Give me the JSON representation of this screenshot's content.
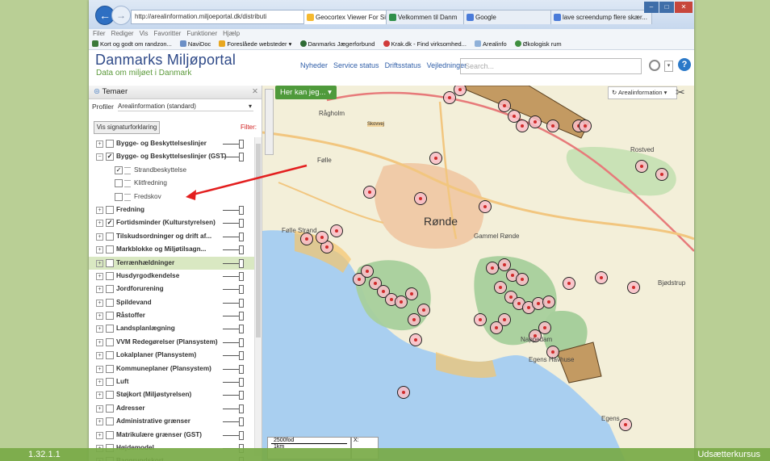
{
  "browser": {
    "address": "http://arealinformation.miljoeportal.dk/distributi",
    "tabs": [
      {
        "label": "Geocortex Viewer For Silv...",
        "active": true,
        "color": "#f5b92f"
      },
      {
        "label": "Velkommen til Danm",
        "active": false,
        "color": "#2f8f4a"
      },
      {
        "label": "Google",
        "active": false,
        "color": "#4a7bd9"
      },
      {
        "label": "lave screendump flere skær...",
        "active": false,
        "color": "#4a7bd9"
      }
    ],
    "menu": [
      "Filer",
      "Rediger",
      "Vis",
      "Favoritter",
      "Funktioner",
      "Hjælp"
    ],
    "favorites": [
      "Kort og godt om randzon...",
      "NaviDoc",
      "Foreslåede websteder ▾",
      "Danmarks Jægerforbund",
      "Krak.dk - Find virksomhed...",
      "Arealinfo",
      "Økologisk rum"
    ]
  },
  "app": {
    "logo_title": "Danmarks Miljøportal",
    "logo_subtitle": "Data om miljøet i Danmark",
    "nav": [
      "Nyheder",
      "Service status",
      "Driftsstatus",
      "Vejledninger"
    ],
    "search_placeholder": "Search..."
  },
  "sidebar": {
    "title": "Temaer",
    "profile_label": "Profiler",
    "profile_value": "Arealinformation (standard)",
    "signature_button": "Vis signaturforklaring",
    "filter_label": "Filter:",
    "layers": [
      {
        "label": "Bygge- og Beskyttelseslinjer",
        "sub": false,
        "checked": false,
        "expanded": false
      },
      {
        "label": "Bygge- og Beskyttelseslinjer (GST)",
        "sub": false,
        "checked": true,
        "expanded": true
      },
      {
        "label": "Strandbeskyttelse",
        "sub": true,
        "checked": true
      },
      {
        "label": "Klitfredning",
        "sub": true,
        "checked": false
      },
      {
        "label": "Fredskov",
        "sub": true,
        "checked": false
      },
      {
        "label": "Fredning",
        "sub": false,
        "checked": false,
        "expanded": false
      },
      {
        "label": "Fortidsminder (Kulturstyrelsen)",
        "sub": false,
        "checked": true,
        "expanded": false
      },
      {
        "label": "Tilskudsordninger og drift af...",
        "sub": false,
        "checked": false,
        "expanded": false
      },
      {
        "label": "Markblokke og Miljøtilsagn...",
        "sub": false,
        "checked": false,
        "expanded": false
      },
      {
        "label": "Terrænhældninger",
        "sub": false,
        "checked": false,
        "expanded": false,
        "highlight": true
      },
      {
        "label": "Husdyrgodkendelse",
        "sub": false,
        "checked": false,
        "expanded": false
      },
      {
        "label": "Jordforurening",
        "sub": false,
        "checked": false,
        "expanded": false
      },
      {
        "label": "Spildevand",
        "sub": false,
        "checked": false,
        "expanded": false
      },
      {
        "label": "Råstoffer",
        "sub": false,
        "checked": false,
        "expanded": false
      },
      {
        "label": "Landsplanlægning",
        "sub": false,
        "checked": false,
        "expanded": false
      },
      {
        "label": "VVM Redegørelser (Plansystem)",
        "sub": false,
        "checked": false,
        "expanded": false
      },
      {
        "label": "Lokalplaner (Plansystem)",
        "sub": false,
        "checked": false,
        "expanded": false
      },
      {
        "label": "Kommuneplaner (Plansystem)",
        "sub": false,
        "checked": false,
        "expanded": false
      },
      {
        "label": "Luft",
        "sub": false,
        "checked": false,
        "expanded": false
      },
      {
        "label": "Støjkort (Miljøstyrelsen)",
        "sub": false,
        "checked": false,
        "expanded": false
      },
      {
        "label": "Adresser",
        "sub": false,
        "checked": false,
        "expanded": false
      },
      {
        "label": "Administrative grænser",
        "sub": false,
        "checked": false,
        "expanded": false
      },
      {
        "label": "Matrikulære grænser (GST)",
        "sub": false,
        "checked": false,
        "expanded": false
      },
      {
        "label": "Højdemodel",
        "sub": false,
        "checked": false,
        "expanded": false
      },
      {
        "label": "Baggrundskort",
        "sub": false,
        "checked": false,
        "expanded": false
      }
    ]
  },
  "map": {
    "her_kan_jeg": "Her kan jeg... ▾",
    "area_button": "Arealinformation ▾",
    "scale_top": "2500fod",
    "scale_bottom": "1km",
    "coord_label": "X:",
    "places": [
      {
        "name": "Rågholm",
        "cls": ""
      },
      {
        "name": "Rønde",
        "cls": "big"
      },
      {
        "name": "Følle Strand",
        "cls": ""
      },
      {
        "name": "Rostved",
        "cls": ""
      },
      {
        "name": "Bjødstrup",
        "cls": ""
      },
      {
        "name": "Egens Havhuse",
        "cls": ""
      },
      {
        "name": "Egens",
        "cls": ""
      },
      {
        "name": "Gammel Rønde",
        "cls": ""
      },
      {
        "name": "Skovvej",
        "cls": "road"
      },
      {
        "name": "Nappedam",
        "cls": ""
      },
      {
        "name": "Følle",
        "cls": ""
      }
    ]
  },
  "footer": {
    "left": "1.32.1.1",
    "right": "Udsætterkursus"
  }
}
